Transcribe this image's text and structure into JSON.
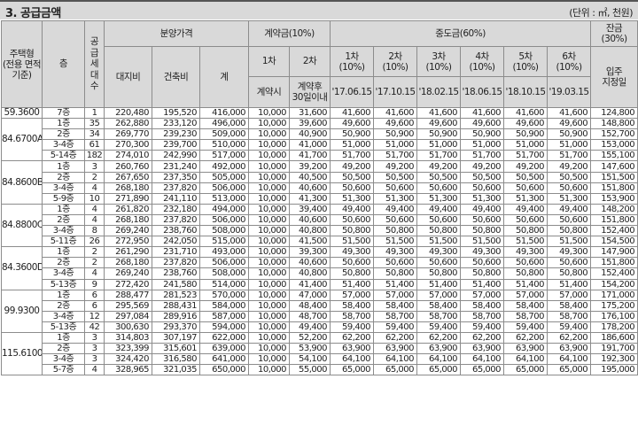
{
  "title": "3. 공급금액",
  "unit_note": "(단위 : ㎡, 천원)",
  "headers": {
    "type": "주택형\n(전용 면적\n기준)",
    "floor": "층",
    "units": "공\n급\n세\n대\n수",
    "sale_price": "분양가격",
    "land": "대지비",
    "building": "건축비",
    "total": "계",
    "contract": "계약금(10%)",
    "c1": "1차",
    "c2": "2차",
    "c1_when": "계약시",
    "c2_when": "계약후\n30일이내",
    "middle": "중도금(60%)",
    "m1": "1차\n(10%)",
    "m2": "2차\n(10%)",
    "m3": "3차\n(10%)",
    "m4": "4차\n(10%)",
    "m5": "5차\n(10%)",
    "m6": "6차\n(10%)",
    "d1": "'17.06.15",
    "d2": "'17.10.15",
    "d3": "'18.02.15",
    "d4": "'18.06.15",
    "d5": "'18.10.15",
    "d6": "'19.03.15",
    "balance": "잔금\n(30%)",
    "movein": "입주\n지정일"
  },
  "groups": [
    {
      "type": "59.3600",
      "rows": [
        [
          "7층",
          "1",
          "220,480",
          "195,520",
          "416,000",
          "10,000",
          "31,600",
          "41,600",
          "41,600",
          "41,600",
          "41,600",
          "41,600",
          "41,600",
          "124,800"
        ]
      ]
    },
    {
      "type": "84.6700A",
      "rows": [
        [
          "1층",
          "35",
          "262,880",
          "233,120",
          "496,000",
          "10,000",
          "39,600",
          "49,600",
          "49,600",
          "49,600",
          "49,600",
          "49,600",
          "49,600",
          "148,800"
        ],
        [
          "2층",
          "34",
          "269,770",
          "239,230",
          "509,000",
          "10,000",
          "40,900",
          "50,900",
          "50,900",
          "50,900",
          "50,900",
          "50,900",
          "50,900",
          "152,700"
        ],
        [
          "3-4층",
          "61",
          "270,300",
          "239,700",
          "510,000",
          "10,000",
          "41,000",
          "51,000",
          "51,000",
          "51,000",
          "51,000",
          "51,000",
          "51,000",
          "153,000"
        ],
        [
          "5-14층",
          "182",
          "274,010",
          "242,990",
          "517,000",
          "10,000",
          "41,700",
          "51,700",
          "51,700",
          "51,700",
          "51,700",
          "51,700",
          "51,700",
          "155,100"
        ]
      ]
    },
    {
      "type": "84.8600B",
      "rows": [
        [
          "1층",
          "3",
          "260,760",
          "231,240",
          "492,000",
          "10,000",
          "39,200",
          "49,200",
          "49,200",
          "49,200",
          "49,200",
          "49,200",
          "49,200",
          "147,600"
        ],
        [
          "2층",
          "2",
          "267,650",
          "237,350",
          "505,000",
          "10,000",
          "40,500",
          "50,500",
          "50,500",
          "50,500",
          "50,500",
          "50,500",
          "50,500",
          "151,500"
        ],
        [
          "3-4층",
          "4",
          "268,180",
          "237,820",
          "506,000",
          "10,000",
          "40,600",
          "50,600",
          "50,600",
          "50,600",
          "50,600",
          "50,600",
          "50,600",
          "151,800"
        ],
        [
          "5-9층",
          "10",
          "271,890",
          "241,110",
          "513,000",
          "10,000",
          "41,300",
          "51,300",
          "51,300",
          "51,300",
          "51,300",
          "51,300",
          "51,300",
          "153,900"
        ]
      ]
    },
    {
      "type": "84.8800C",
      "rows": [
        [
          "1층",
          "4",
          "261,820",
          "232,180",
          "494,000",
          "10,000",
          "39,400",
          "49,400",
          "49,400",
          "49,400",
          "49,400",
          "49,400",
          "49,400",
          "148,200"
        ],
        [
          "2층",
          "4",
          "268,180",
          "237,820",
          "506,000",
          "10,000",
          "40,600",
          "50,600",
          "50,600",
          "50,600",
          "50,600",
          "50,600",
          "50,600",
          "151,800"
        ],
        [
          "3-4층",
          "8",
          "269,240",
          "238,760",
          "508,000",
          "10,000",
          "40,800",
          "50,800",
          "50,800",
          "50,800",
          "50,800",
          "50,800",
          "50,800",
          "152,400"
        ],
        [
          "5-11층",
          "26",
          "272,950",
          "242,050",
          "515,000",
          "10,000",
          "41,500",
          "51,500",
          "51,500",
          "51,500",
          "51,500",
          "51,500",
          "51,500",
          "154,500"
        ]
      ]
    },
    {
      "type": "84.3600D",
      "rows": [
        [
          "1층",
          "2",
          "261,290",
          "231,710",
          "493,000",
          "10,000",
          "39,300",
          "49,300",
          "49,300",
          "49,300",
          "49,300",
          "49,300",
          "49,300",
          "147,900"
        ],
        [
          "2층",
          "2",
          "268,180",
          "237,820",
          "506,000",
          "10,000",
          "40,600",
          "50,600",
          "50,600",
          "50,600",
          "50,600",
          "50,600",
          "50,600",
          "151,800"
        ],
        [
          "3-4층",
          "4",
          "269,240",
          "238,760",
          "508,000",
          "10,000",
          "40,800",
          "50,800",
          "50,800",
          "50,800",
          "50,800",
          "50,800",
          "50,800",
          "152,400"
        ],
        [
          "5-13층",
          "9",
          "272,420",
          "241,580",
          "514,000",
          "10,000",
          "41,400",
          "51,400",
          "51,400",
          "51,400",
          "51,400",
          "51,400",
          "51,400",
          "154,200"
        ]
      ]
    },
    {
      "type": "99.9300",
      "rows": [
        [
          "1층",
          "6",
          "288,477",
          "281,523",
          "570,000",
          "10,000",
          "47,000",
          "57,000",
          "57,000",
          "57,000",
          "57,000",
          "57,000",
          "57,000",
          "171,000"
        ],
        [
          "2층",
          "6",
          "295,569",
          "288,431",
          "584,000",
          "10,000",
          "48,400",
          "58,400",
          "58,400",
          "58,400",
          "58,400",
          "58,400",
          "58,400",
          "175,200"
        ],
        [
          "3-4층",
          "12",
          "297,084",
          "289,916",
          "587,000",
          "10,000",
          "48,700",
          "58,700",
          "58,700",
          "58,700",
          "58,700",
          "58,700",
          "58,700",
          "176,100"
        ],
        [
          "5-13층",
          "42",
          "300,630",
          "293,370",
          "594,000",
          "10,000",
          "49,400",
          "59,400",
          "59,400",
          "59,400",
          "59,400",
          "59,400",
          "59,400",
          "178,200"
        ]
      ]
    },
    {
      "type": "115.6100",
      "rows": [
        [
          "1층",
          "3",
          "314,803",
          "307,197",
          "622,000",
          "10,000",
          "52,200",
          "62,200",
          "62,200",
          "62,200",
          "62,200",
          "62,200",
          "62,200",
          "186,600"
        ],
        [
          "2층",
          "3",
          "323,399",
          "315,601",
          "639,000",
          "10,000",
          "53,900",
          "63,900",
          "63,900",
          "63,900",
          "63,900",
          "63,900",
          "63,900",
          "191,700"
        ],
        [
          "3-4층",
          "3",
          "324,420",
          "316,580",
          "641,000",
          "10,000",
          "54,100",
          "64,100",
          "64,100",
          "64,100",
          "64,100",
          "64,100",
          "64,100",
          "192,300"
        ],
        [
          "5-7층",
          "4",
          "328,965",
          "321,035",
          "650,000",
          "10,000",
          "55,000",
          "65,000",
          "65,000",
          "65,000",
          "65,000",
          "65,000",
          "65,000",
          "195,000"
        ]
      ]
    }
  ]
}
